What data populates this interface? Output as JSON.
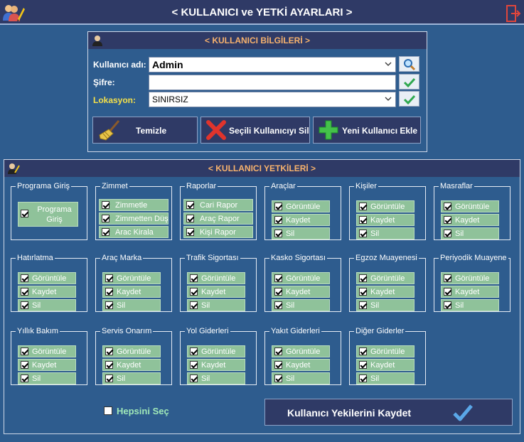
{
  "window": {
    "title": "< KULLANICI ve YETKİ AYARLARI >"
  },
  "icons": {
    "app": "users-edit-icon",
    "exit": "exit-door-icon"
  },
  "user_info": {
    "title": "< KULLANICI BİLGİLERİ >",
    "username_label": "Kullanıcı adı:",
    "username_value": "Admin",
    "password_label": "Şifre:",
    "password_value": "",
    "location_label": "Lokasyon:",
    "location_value": "SINIRSIZ",
    "clear_label": "Temizle",
    "delete_label": "Seçili Kullanıcıyı Sil",
    "new_label": "Yeni Kullanıcı Ekle"
  },
  "permissions": {
    "title": "< KULLANICI YETKİLERİ >",
    "groups": [
      {
        "name": "Programa Giriş",
        "items": [
          "Programa Giriş"
        ]
      },
      {
        "name": "Zimmet",
        "items": [
          "Zimmetle",
          "Zimmetten Düş",
          "Arac Kirala"
        ]
      },
      {
        "name": "Raporlar",
        "items": [
          "Cari Rapor",
          "Araç Rapor",
          "Kişi Rapor"
        ]
      },
      {
        "name": "Araçlar",
        "items": [
          "Görüntüle",
          "Kaydet",
          "Sil"
        ]
      },
      {
        "name": "Kişiler",
        "items": [
          "Görüntüle",
          "Kaydet",
          "Sil"
        ]
      },
      {
        "name": "Masraflar",
        "items": [
          "Görüntüle",
          "Kaydet",
          "Sil"
        ]
      },
      {
        "name": "Hatırlatma",
        "items": [
          "Görüntüle",
          "Kaydet",
          "Sil"
        ]
      },
      {
        "name": "Araç Marka",
        "items": [
          "Görüntüle",
          "Kaydet",
          "Sil"
        ]
      },
      {
        "name": "Trafik Sigortası",
        "items": [
          "Görüntüle",
          "Kaydet",
          "Sil"
        ]
      },
      {
        "name": "Kasko Sigortası",
        "items": [
          "Görüntüle",
          "Kaydet",
          "Sil"
        ]
      },
      {
        "name": "Egzoz Muayenesi",
        "items": [
          "Görüntüle",
          "Kaydet",
          "Sil"
        ]
      },
      {
        "name": "Periyodik Muayene",
        "items": [
          "Görüntüle",
          "Kaydet",
          "Sil"
        ]
      },
      {
        "name": "Yıllık Bakım",
        "items": [
          "Görüntüle",
          "Kaydet",
          "Sil"
        ]
      },
      {
        "name": "Servis Onarım",
        "items": [
          "Görüntüle",
          "Kaydet",
          "Sil"
        ]
      },
      {
        "name": "Yol Giderleri",
        "items": [
          "Görüntüle",
          "Kaydet",
          "Sil"
        ]
      },
      {
        "name": "Yakıt Giderleri",
        "items": [
          "Görüntüle",
          "Kaydet",
          "Sil"
        ]
      },
      {
        "name": "Diğer Giderler",
        "items": [
          "Görüntüle",
          "Kaydet",
          "Sil"
        ]
      }
    ],
    "select_all_label": "Hepsini Seç",
    "save_label": "Kullanıcı Yekilerini Kaydet"
  }
}
